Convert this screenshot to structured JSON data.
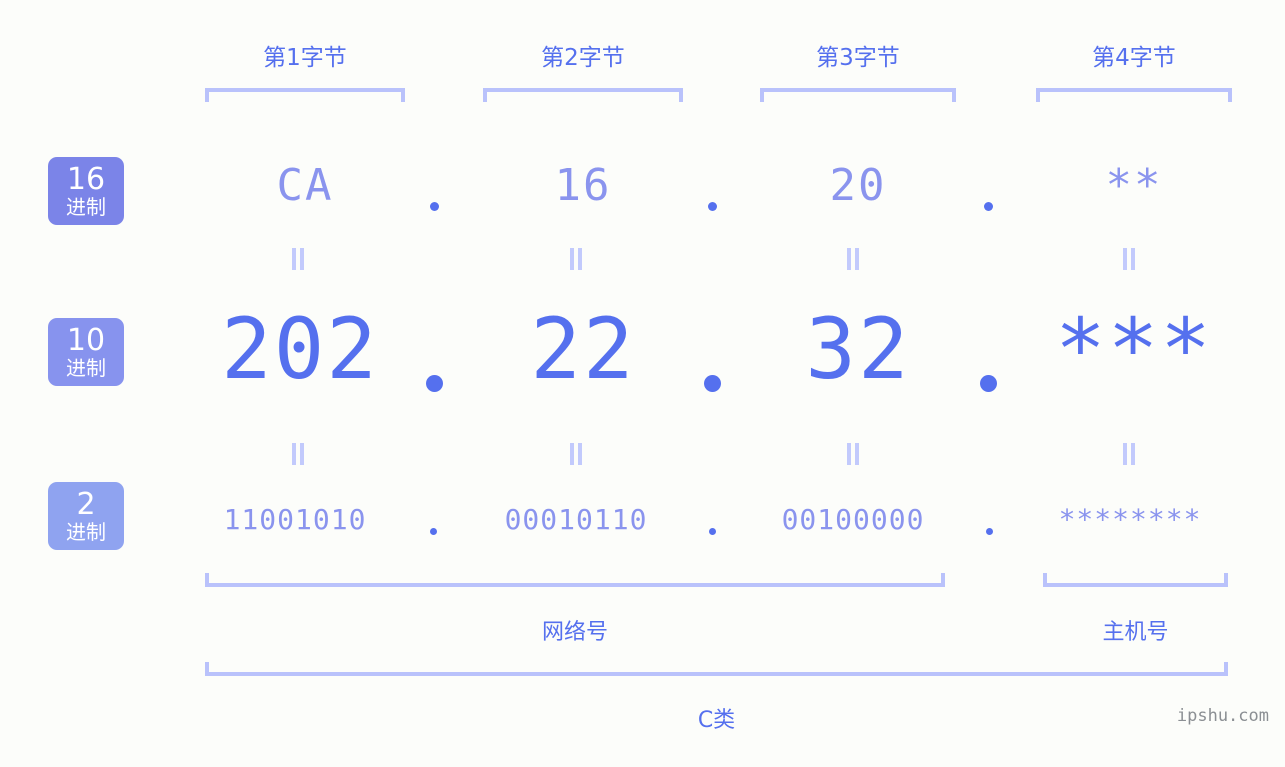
{
  "diagram": {
    "byte_headers": [
      {
        "label": "第1字节"
      },
      {
        "label": "第2字节"
      },
      {
        "label": "第3字节"
      },
      {
        "label": "第4字节"
      }
    ],
    "bases": [
      {
        "num": "16",
        "unit": "进制",
        "color": "#7b84e8"
      },
      {
        "num": "10",
        "unit": "进制",
        "color": "#8793ee"
      },
      {
        "num": "2",
        "unit": "进制",
        "color": "#8fa3f0"
      }
    ],
    "rows": {
      "hex": {
        "octets": [
          "CA",
          "16",
          "20",
          "**"
        ]
      },
      "decimal": {
        "octets": [
          "202",
          "22",
          "32",
          "***"
        ]
      },
      "binary": {
        "octets": [
          "11001010",
          "00010110",
          "00100000",
          "********"
        ]
      }
    },
    "separator": ".",
    "equals": "=",
    "footer": {
      "network_label": "网络号",
      "host_label": "主机号",
      "class_label": "C类"
    },
    "watermark": "ipshu.com"
  },
  "colors": {
    "background": "#fcfdfa",
    "accent": "#5570ee",
    "accent_light": "#8a94ee",
    "bracket": "#b9c2fb",
    "equals": "#c2cafc",
    "watermark": "#8b8f93"
  }
}
